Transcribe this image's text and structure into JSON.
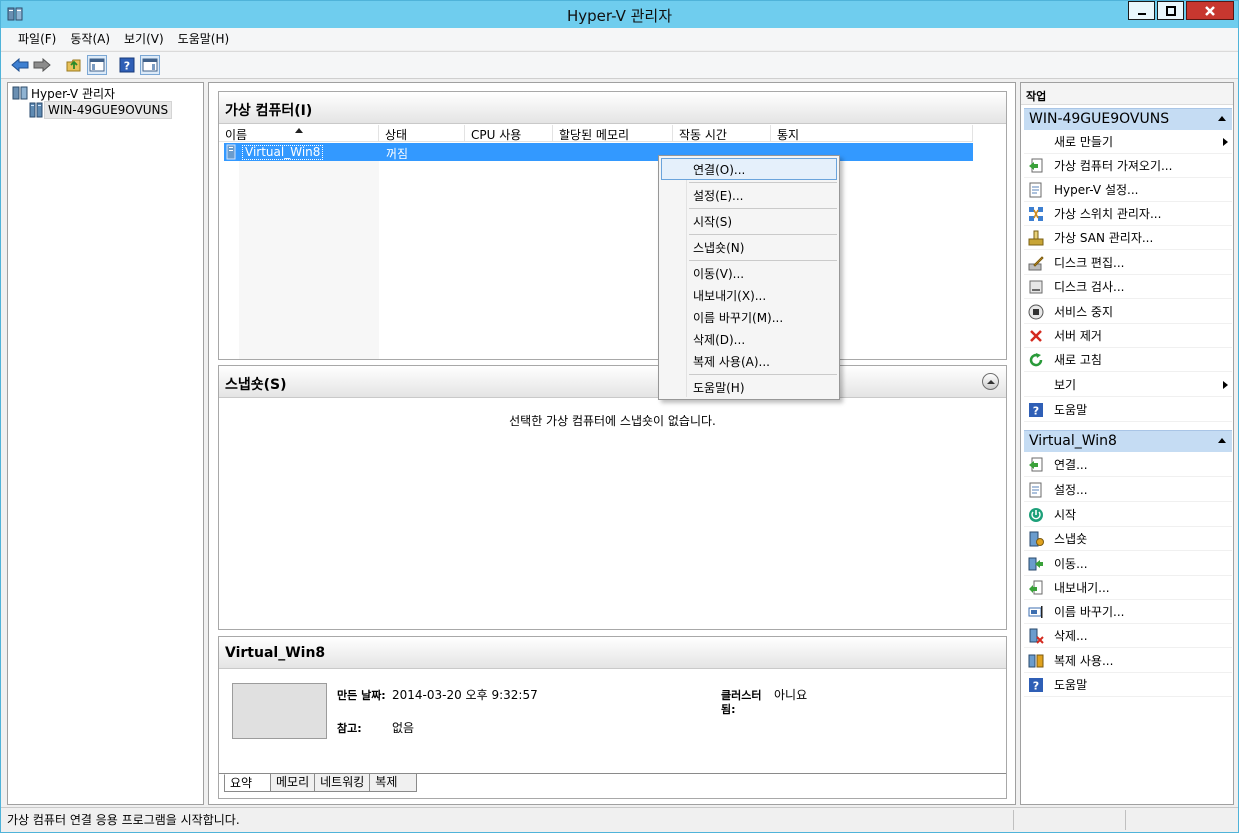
{
  "window": {
    "title": "Hyper-V 관리자"
  },
  "menu": {
    "items": [
      "파일(F)",
      "동작(A)",
      "보기(V)",
      "도움말(H)"
    ]
  },
  "toolbar": {
    "icons": [
      "back-arrow-icon",
      "forward-arrow-icon",
      "folder-up-icon",
      "show-hide-tree-icon",
      "help-icon",
      "show-hide-action-pane-icon"
    ]
  },
  "nav": {
    "root_label": "Hyper-V 관리자",
    "server_label": "WIN-49GUE9OVUNS"
  },
  "vm_panel": {
    "title": "가상 컴퓨터(I)",
    "columns": [
      "이름",
      "상태",
      "CPU 사용",
      "할당된 메모리",
      "작동 시간",
      "통지"
    ],
    "rows": [
      {
        "name": "Virtual_Win8",
        "state": "꺼짐"
      }
    ]
  },
  "context_menu": {
    "items": [
      "연결(O)...",
      "설정(E)...",
      "시작(S)",
      "스냅숏(N)",
      "이동(V)...",
      "내보내기(X)...",
      "이름 바꾸기(M)...",
      "삭제(D)...",
      "복제 사용(A)...",
      "도움말(H)"
    ]
  },
  "snapshot_panel": {
    "title": "스냅숏(S)",
    "empty_message": "선택한 가상 컴퓨터에 스냅숏이 없습니다."
  },
  "details_panel": {
    "title": "Virtual_Win8",
    "created_label": "만든 날짜:",
    "created_value": "2014-03-20 오후 9:32:57",
    "notes_label": "참고:",
    "notes_value": "없음",
    "cluster_label_1": "클러스터",
    "cluster_label_2": "됨:",
    "cluster_value": "아니요",
    "tabs": [
      "요약",
      "메모리",
      "네트워킹",
      "복제"
    ]
  },
  "actions": {
    "title": "작업",
    "server_header": "WIN-49GUE9OVUNS",
    "server_items": [
      "새로 만들기",
      "가상 컴퓨터 가져오기...",
      "Hyper-V 설정...",
      "가상 스위치 관리자...",
      "가상 SAN 관리자...",
      "디스크 편집...",
      "디스크 검사...",
      "서비스 중지",
      "서버 제거",
      "새로 고침",
      "보기",
      "도움말"
    ],
    "vm_header": "Virtual_Win8",
    "vm_items": [
      "연결...",
      "설정...",
      "시작",
      "스냅숏",
      "이동...",
      "내보내기...",
      "이름 바꾸기...",
      "삭제...",
      "복제 사용...",
      "도움말"
    ]
  },
  "status": {
    "text": "가상 컴퓨터 연결 응용 프로그램을 시작합니다."
  },
  "colors": {
    "titlebar": "#6fcdee",
    "selection": "#3399ff",
    "action_header": "#c5dcf3"
  }
}
